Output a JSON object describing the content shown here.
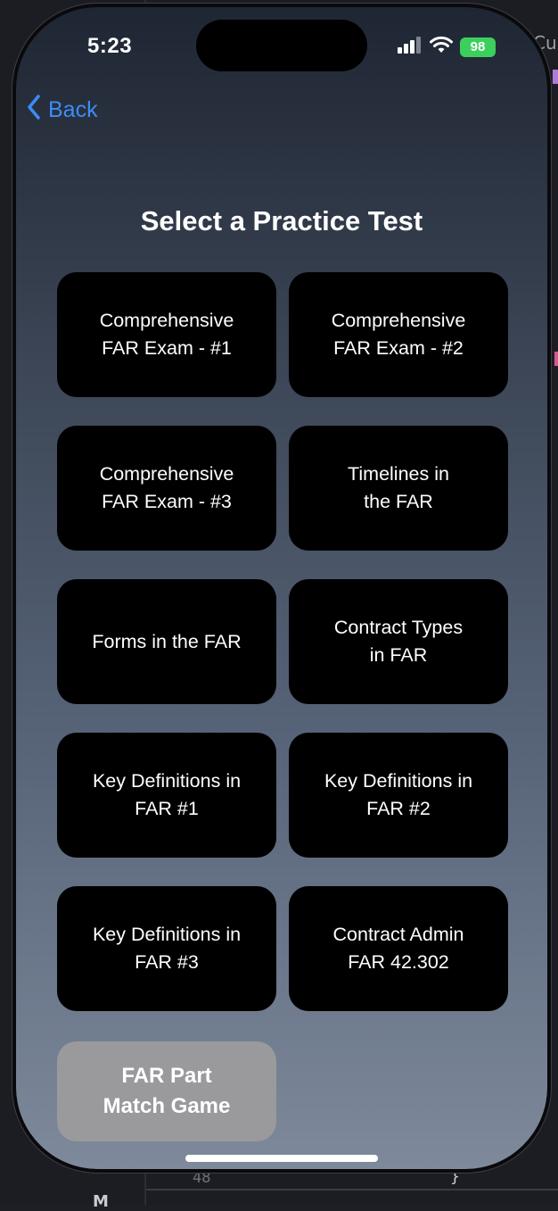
{
  "status_bar": {
    "time": "5:23",
    "battery": "98"
  },
  "nav": {
    "back_label": "Back"
  },
  "page": {
    "title": "Select a Practice Test"
  },
  "tests": [
    {
      "label": "Comprehensive\nFAR Exam - #1"
    },
    {
      "label": "Comprehensive\nFAR Exam - #2"
    },
    {
      "label": "Comprehensive\nFAR Exam - #3"
    },
    {
      "label": "Timelines in\nthe FAR"
    },
    {
      "label": "Forms in the FAR"
    },
    {
      "label": "Contract Types\nin FAR"
    },
    {
      "label": "Key Definitions in\nFAR #1"
    },
    {
      "label": "Key Definitions in\nFAR #2"
    },
    {
      "label": "Key Definitions in\nFAR #3"
    },
    {
      "label": "Contract Admin\nFAR 42.302"
    }
  ],
  "game": {
    "label": "FAR Part\nMatch Game"
  },
  "background_editor": {
    "line_number": "48",
    "brace": "}",
    "letter": "M",
    "side_text": "Cu"
  },
  "colors": {
    "accent": "#3d8cf5",
    "card_bg": "#000000",
    "game_bg": "#9a9a9c",
    "battery": "#3ccf5d"
  }
}
